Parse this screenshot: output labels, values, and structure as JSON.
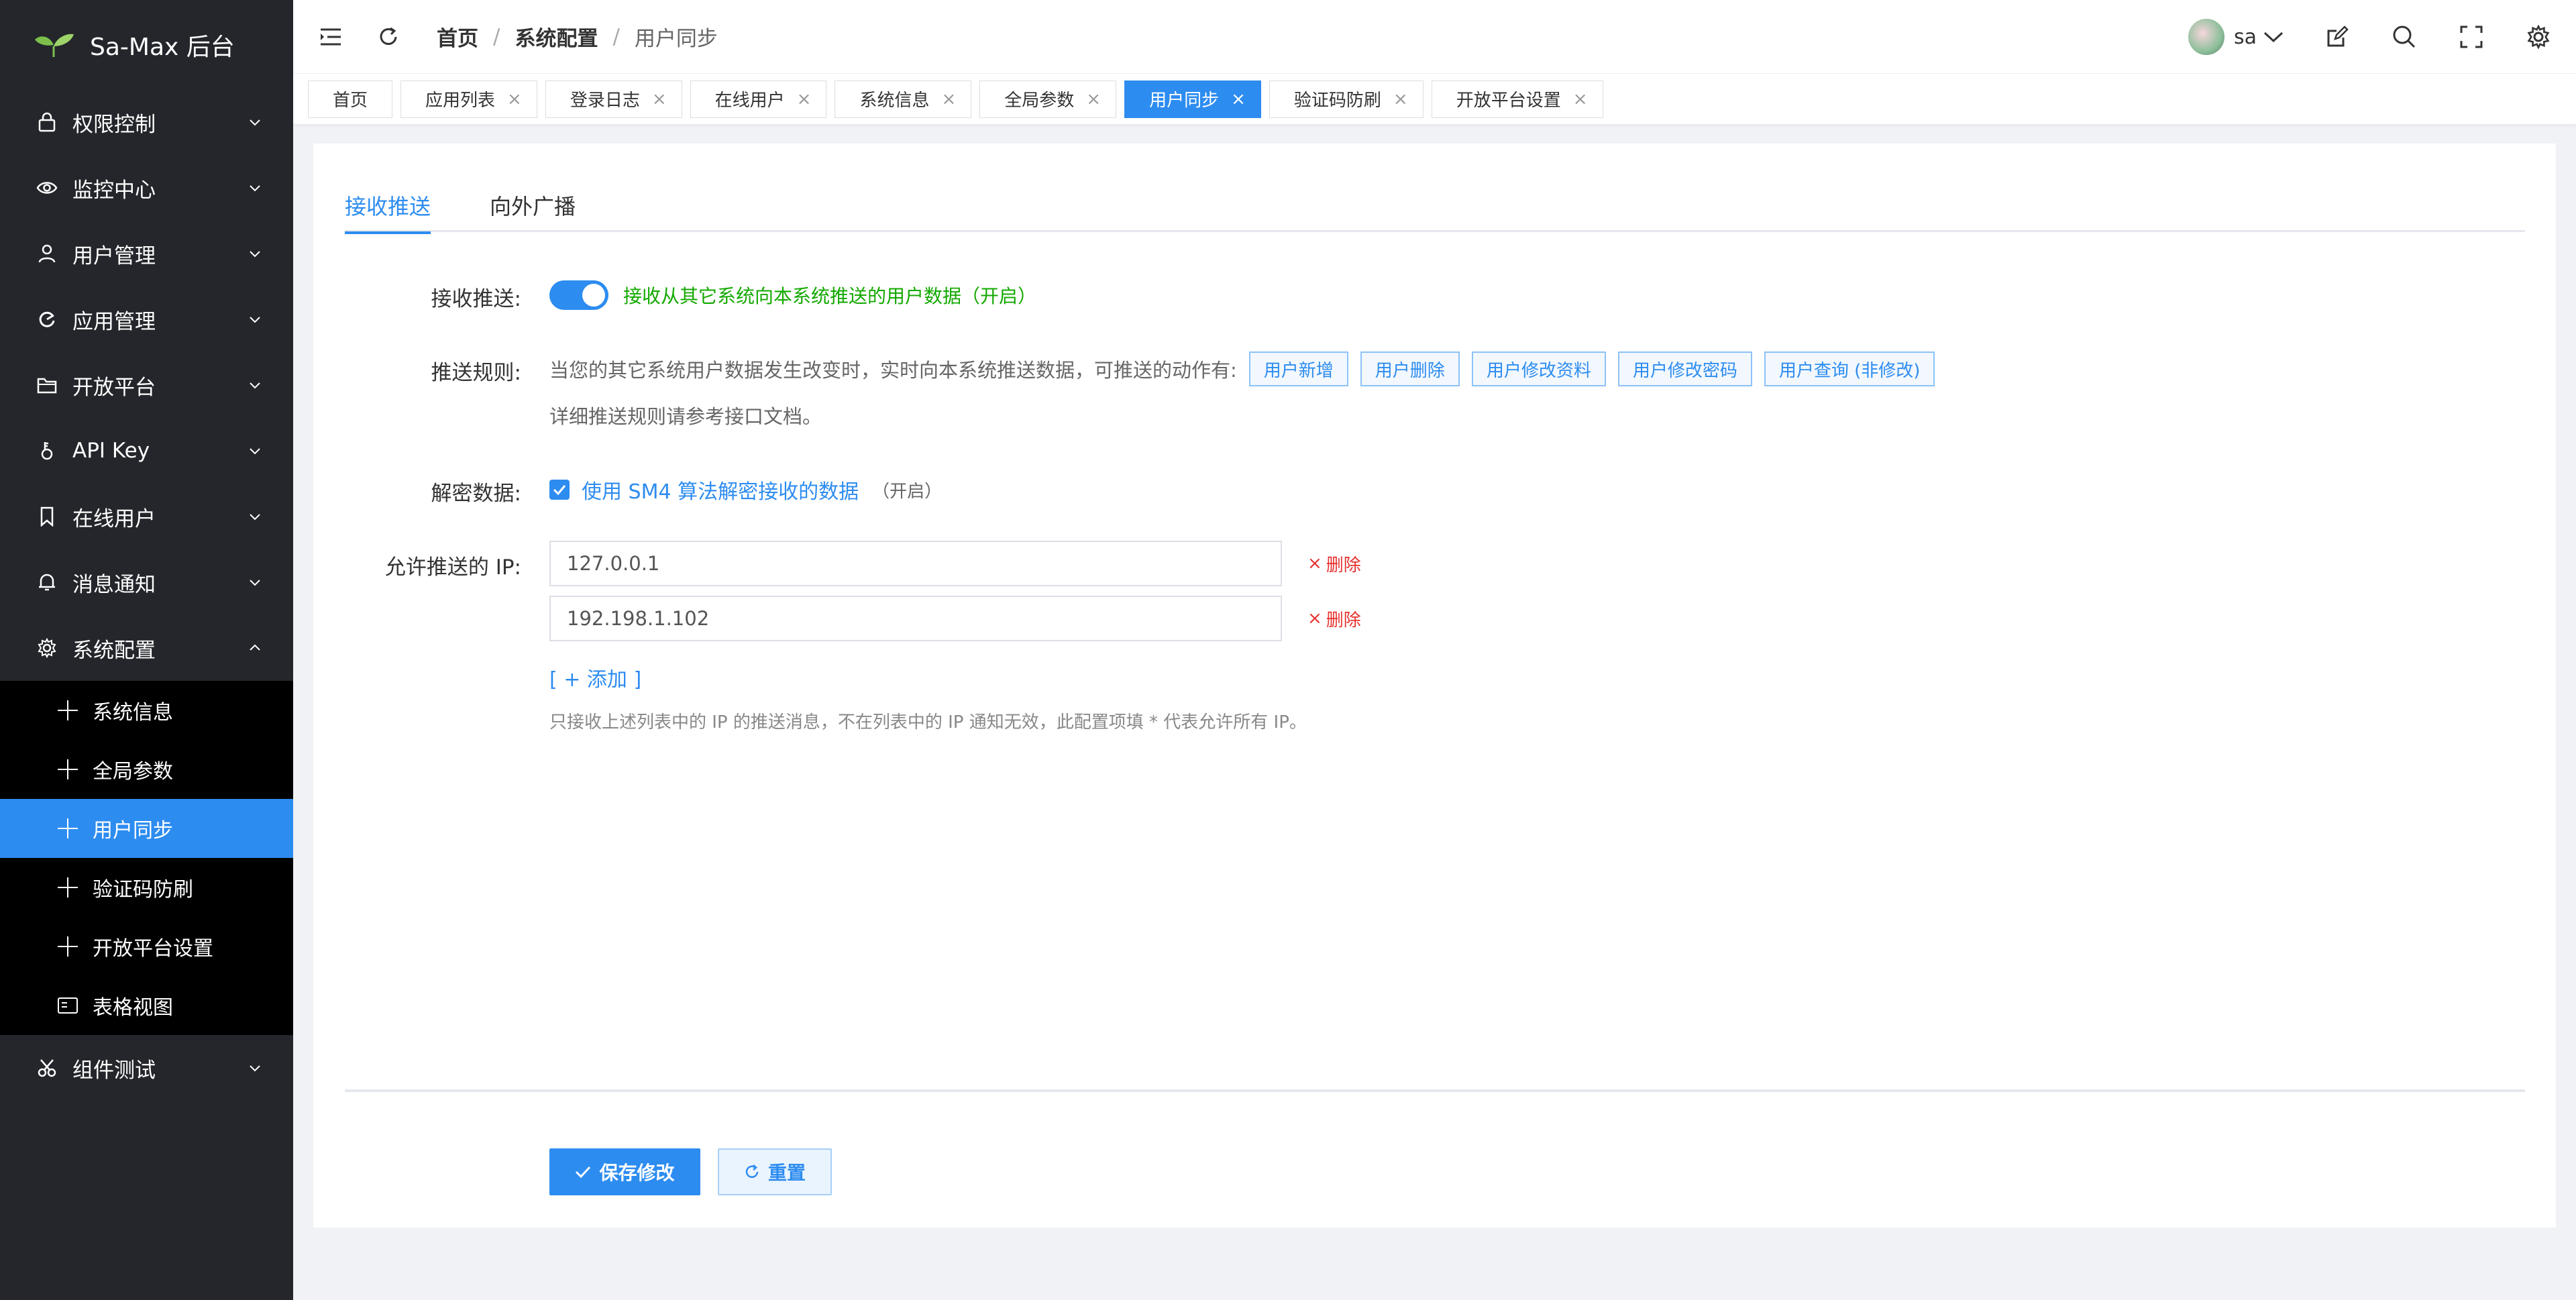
{
  "app": {
    "title": "Sa-Max 后台",
    "accent": "#2d8cf0"
  },
  "sidebar": {
    "items": [
      {
        "label": "权限控制",
        "icon": "lock-icon"
      },
      {
        "label": "监控中心",
        "icon": "eye-icon"
      },
      {
        "label": "用户管理",
        "icon": "user-icon"
      },
      {
        "label": "应用管理",
        "icon": "app-icon"
      },
      {
        "label": "开放平台",
        "icon": "folder-icon"
      },
      {
        "label": "API Key",
        "icon": "key-icon"
      },
      {
        "label": "在线用户",
        "icon": "bookmark-icon"
      },
      {
        "label": "消息通知",
        "icon": "bell-icon"
      },
      {
        "label": "系统配置",
        "icon": "gear-icon"
      }
    ],
    "sub_items": [
      {
        "label": "系统信息"
      },
      {
        "label": "全局参数"
      },
      {
        "label": "用户同步"
      },
      {
        "label": "验证码防刷"
      },
      {
        "label": "开放平台设置"
      },
      {
        "label": "表格视图"
      }
    ],
    "last_item": {
      "label": "组件测试",
      "icon": "scissors-icon"
    }
  },
  "header": {
    "breadcrumb": [
      "首页",
      "系统配置",
      "用户同步"
    ],
    "separator": "/",
    "user_name": "sa"
  },
  "tabs": [
    {
      "label": "首页"
    },
    {
      "label": "应用列表"
    },
    {
      "label": "登录日志"
    },
    {
      "label": "在线用户"
    },
    {
      "label": "系统信息"
    },
    {
      "label": "全局参数"
    },
    {
      "label": "用户同步"
    },
    {
      "label": "验证码防刷"
    },
    {
      "label": "开放平台设置"
    }
  ],
  "tab_close": "×",
  "content": {
    "tabs": [
      "接收推送",
      "向外广播"
    ],
    "receive": {
      "label": "接收推送:",
      "enabled": true,
      "status_text": "接收从其它系统向本系统推送的用户数据（开启）"
    },
    "rules": {
      "label": "推送规则:",
      "description": "当您的其它系统用户数据发生改变时，实时向本系统推送数据，可推送的动作有:",
      "actions": [
        "用户新增",
        "用户删除",
        "用户修改资料",
        "用户修改密码",
        "用户查询 (非修改)"
      ],
      "doc_note": "详细推送规则请参考接口文档。"
    },
    "decrypt": {
      "label": "解密数据:",
      "checked": true,
      "checkbox_text": "使用 SM4 算法解密接收的数据",
      "status": "（开启）"
    },
    "ips": {
      "label": "允许推送的 IP:",
      "values": [
        "127.0.0.1",
        "192.198.1.102"
      ],
      "delete_label": "删除",
      "delete_mark": "×",
      "add_label": "[ + 添加 ]",
      "hint": "只接收上述列表中的 IP 的推送消息，不在列表中的 IP 通知无效，此配置项填 * 代表允许所有 IP。"
    },
    "save_label": "保存修改",
    "reset_label": "重置"
  }
}
